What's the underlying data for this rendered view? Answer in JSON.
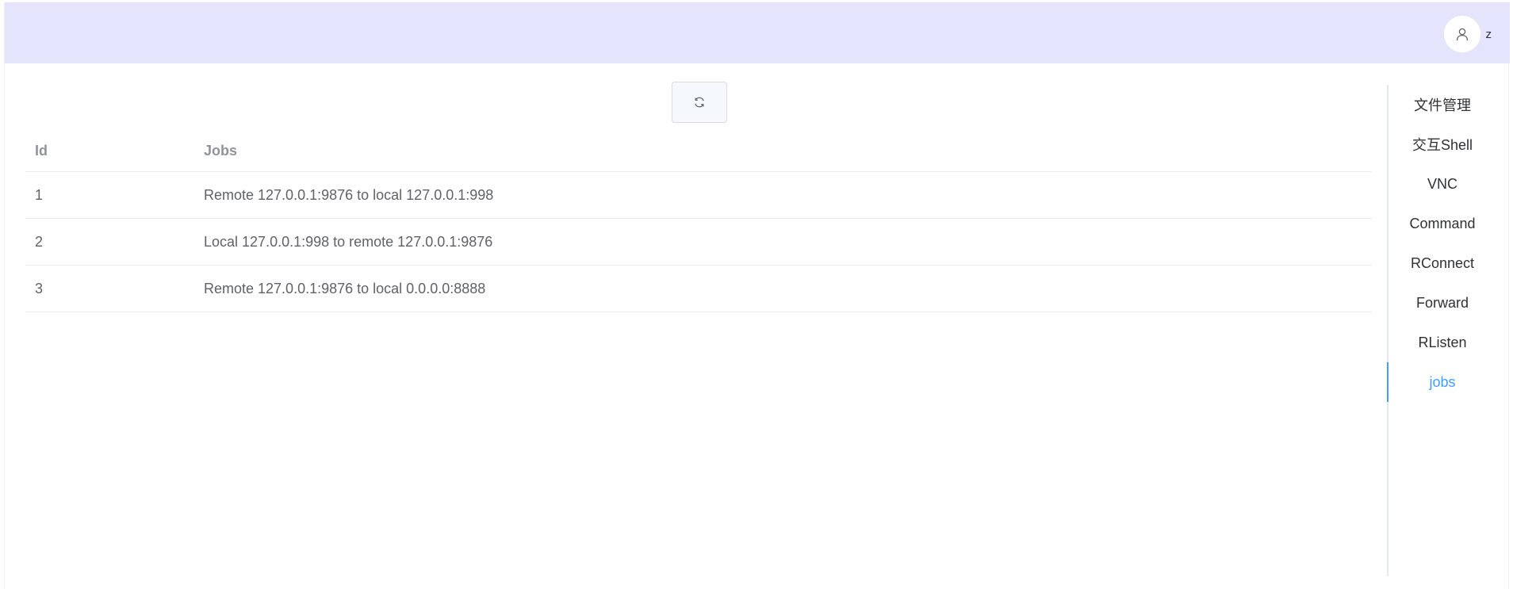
{
  "header": {
    "username": "z",
    "avatar_icon": "user-icon",
    "background": "#e4e5fd"
  },
  "toolbar": {
    "refresh_icon": "refresh-icon"
  },
  "table": {
    "columns": [
      "Id",
      "Jobs"
    ],
    "rows": [
      {
        "id": "1",
        "job": "Remote 127.0.0.1:9876 to local 127.0.0.1:998"
      },
      {
        "id": "2",
        "job": "Local 127.0.0.1:998 to remote 127.0.0.1:9876"
      },
      {
        "id": "3",
        "job": "Remote 127.0.0.1:9876 to local 0.0.0.0:8888"
      }
    ]
  },
  "side_nav": {
    "items": [
      "文件管理",
      "交互Shell",
      "VNC",
      "Command",
      "RConnect",
      "Forward",
      "RListen",
      "jobs"
    ],
    "active": "jobs",
    "active_color": "#409eff"
  }
}
